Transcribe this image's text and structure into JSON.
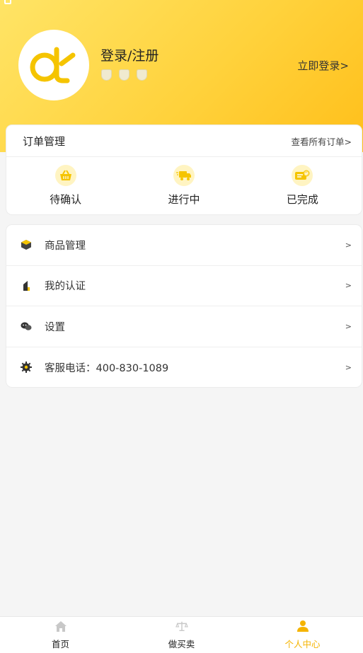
{
  "header": {
    "login_title": "登录/注册",
    "login_now": "立即登录>"
  },
  "orders": {
    "title": "订单管理",
    "view_all": "查看所有订单>",
    "items": [
      {
        "label": "待确认",
        "icon": "basket-icon"
      },
      {
        "label": "进行中",
        "icon": "truck-icon"
      },
      {
        "label": "已完成",
        "icon": "completed-card-icon"
      }
    ]
  },
  "menu": {
    "items": [
      {
        "label": "商品管理",
        "icon": "box-icon",
        "chevron": ">"
      },
      {
        "label": "我的认证",
        "icon": "certificate-icon",
        "chevron": ">"
      },
      {
        "label": "设置",
        "icon": "chat-icon",
        "chevron": ">"
      },
      {
        "label": "客服电话：400-830-1089",
        "icon": "gear-icon",
        "chevron": ">"
      }
    ]
  },
  "tabbar": {
    "items": [
      {
        "label": "首页",
        "icon": "home-icon"
      },
      {
        "label": "做买卖",
        "icon": "scale-icon"
      },
      {
        "label": "个人中心",
        "icon": "person-icon",
        "active": true
      }
    ]
  },
  "colors": {
    "accent": "#ffd23c",
    "active_tab": "#f5b400"
  }
}
